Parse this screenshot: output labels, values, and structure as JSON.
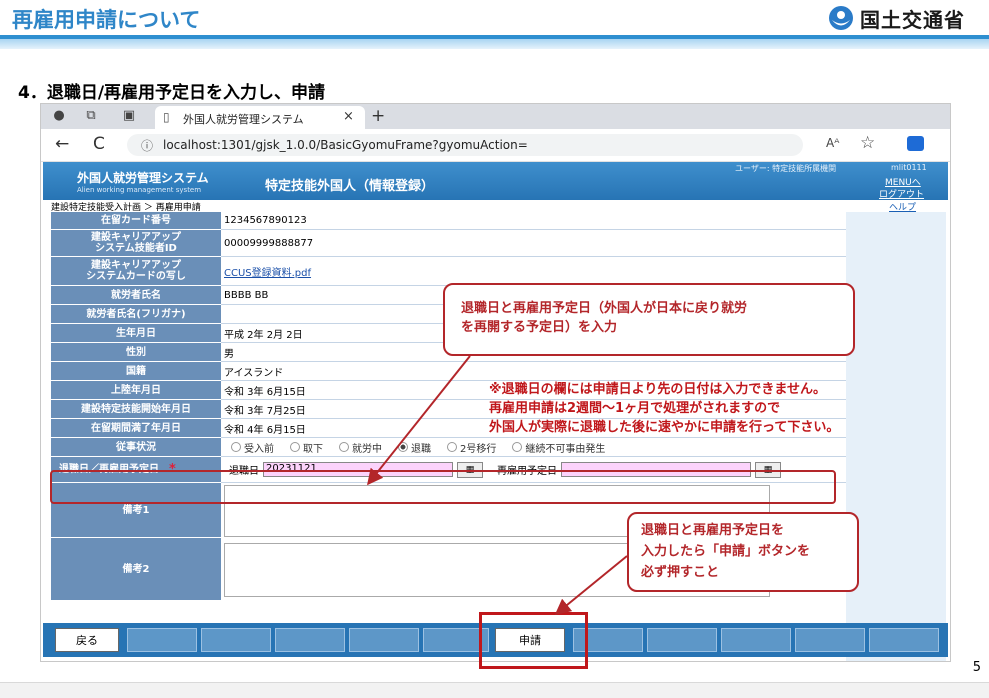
{
  "slide": {
    "title": "再雇用申請について",
    "logo_text": "国土交通省",
    "step_heading": "4．退職日/再雇用予定日を入力し、申請",
    "page_number": "5"
  },
  "browser": {
    "tab_label": "外国人就労管理システム",
    "tab_close": "×",
    "new_tab": "+",
    "url": "localhost:1301/gjsk_1.0.0/BasicGyomuFrame?gyomuAction=",
    "read_aloud": "Á́",
    "back": "←",
    "reload": "C"
  },
  "app": {
    "system_name": "外国人就労管理システム",
    "system_name_en": "Alien working management system",
    "subtitle": "特定技能外国人（情報登録）",
    "user_label": "ユーザー: 特定技能所属機関",
    "user_id": "mlit0111",
    "menu_link": "MENUへ",
    "logout_link": "ログアウト",
    "help_link": "ヘルプ",
    "breadcrumb": "建設特定技能受入計画 ＞ 再雇用申請"
  },
  "form": {
    "rows": [
      {
        "label": "在留カード番号",
        "value": "1234567890123"
      },
      {
        "label": "建設キャリアアップ\nシステム技能者ID",
        "value": "00009999888877"
      },
      {
        "label": "建設キャリアアップ\nシステムカードの写し",
        "value": "CCUS登録資料.pdf"
      },
      {
        "label": "就労者氏名",
        "value": "BBBB BB"
      },
      {
        "label": "就労者氏名(フリガナ)",
        "value": ""
      },
      {
        "label": "生年月日",
        "value": "平成 2年 2月 2日"
      },
      {
        "label": "性別",
        "value": "男"
      },
      {
        "label": "国籍",
        "value": "アイスランド"
      },
      {
        "label": "上陸年月日",
        "value": "令和 3年 6月15日"
      },
      {
        "label": "建設特定技能開始年月日",
        "value": "令和 3年 7月25日"
      },
      {
        "label": "在留期間満了年月日",
        "value": "令和 4年 6月15日"
      }
    ],
    "employment_status_label": "従事状況",
    "employment_status_options": [
      "受入前",
      "取下",
      "就労中",
      "退職",
      "2号移行",
      "継続不可事由発生"
    ],
    "employment_status_selected": "退職",
    "date_row_label": "退職日／再雇用予定日",
    "required_mark": "*",
    "retire_date_label": "退職日",
    "retire_date_value": "20231121",
    "rehire_date_label": "再雇用予定日",
    "rehire_date_value": "",
    "remarks1_label": "備考1",
    "remarks2_label": "備考2"
  },
  "buttons": {
    "back": "戻る",
    "apply": "申請"
  },
  "annotations": {
    "callout_top": "退職日と再雇用予定日（外国人が日本に戻り就労\nを再開する予定日）を入力",
    "note_line1": "※退職日の欄には申請日より先の日付は入力できません。",
    "note_line2": "再雇用申請は2週間～1ヶ月で処理がされますので",
    "note_line3": "外国人が実際に退職した後に速やかに申請を行って下さい。",
    "callout_bottom": "退職日と再雇用予定日を\n入力したら「申請」ボタンを\n必ず押すこと"
  },
  "colors": {
    "title_blue": "#2f86c8",
    "app_header_blue": "#2774b4",
    "label_blue": "#6a8fb8",
    "date_input_pink": "#fcd3fb",
    "annotation_red": "#b3262a"
  }
}
